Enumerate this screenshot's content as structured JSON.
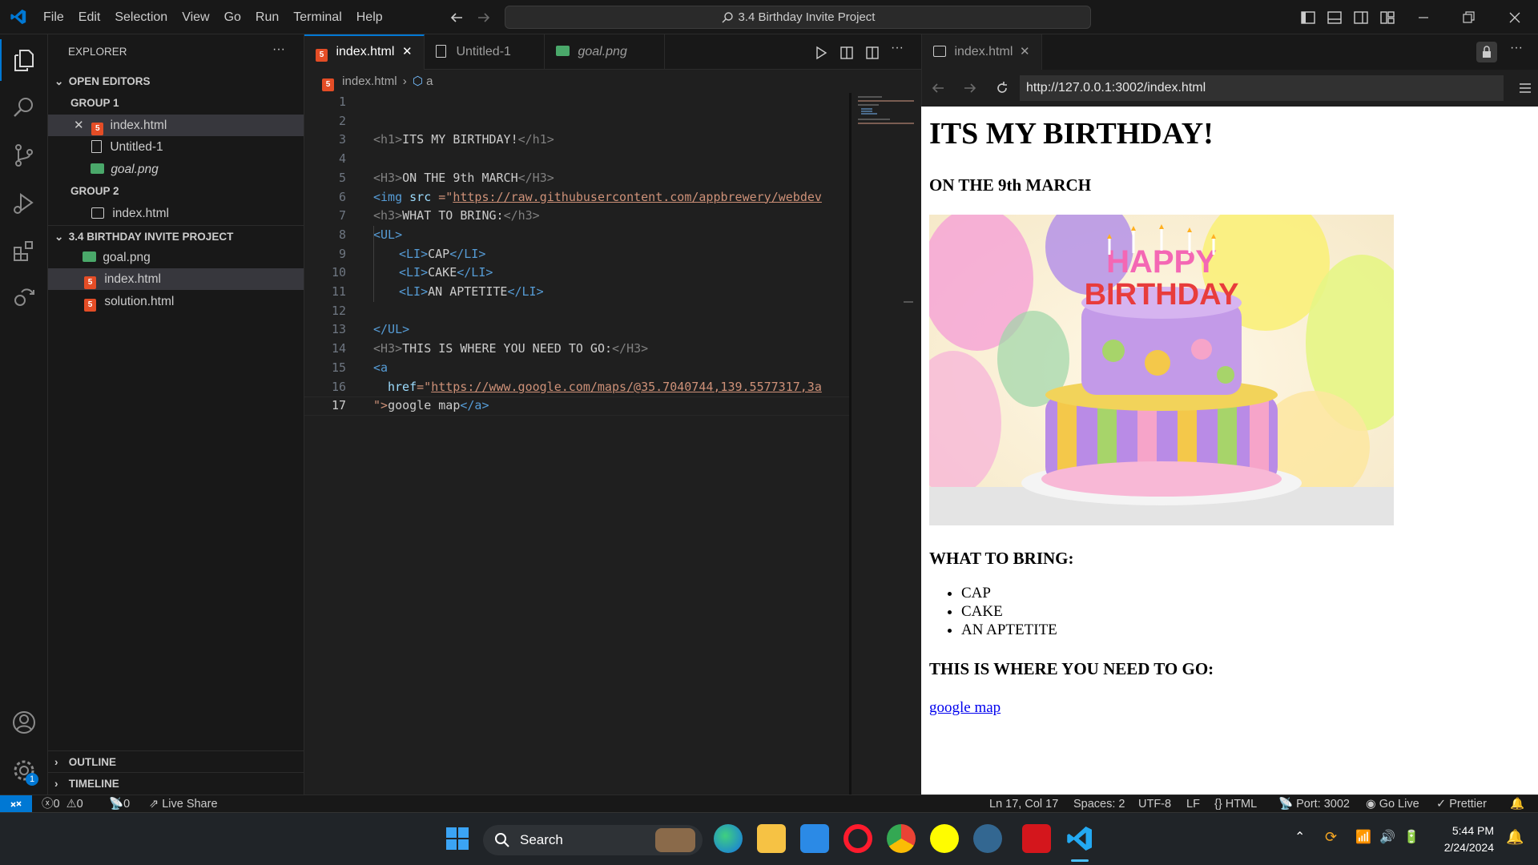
{
  "titlebar": {
    "menus": [
      "File",
      "Edit",
      "Selection",
      "View",
      "Go",
      "Run",
      "Terminal",
      "Help"
    ],
    "command_center": "3.4 Birthday Invite Project"
  },
  "sidebar": {
    "title": "EXPLORER",
    "open_editors": "OPEN EDITORS",
    "group1": "GROUP 1",
    "group1_files": [
      "index.html",
      "Untitled-1",
      "goal.png"
    ],
    "group2": "GROUP 2",
    "group2_files": [
      "index.html"
    ],
    "project": "3.4 BIRTHDAY INVITE PROJECT",
    "project_files": [
      "goal.png",
      "index.html",
      "solution.html"
    ],
    "outline": "OUTLINE",
    "timeline": "TIMELINE",
    "settings_badge": "1"
  },
  "editor": {
    "tabs": [
      "index.html",
      "Untitled-1",
      "goal.png"
    ],
    "breadcrumb_file": "index.html",
    "breadcrumb_symbol": "a",
    "line_numbers": [
      "1",
      "2",
      "3",
      "4",
      "5",
      "6",
      "7",
      "8",
      "9",
      "10",
      "11",
      "12",
      "13",
      "14",
      "15",
      "16",
      "17"
    ],
    "lines": {
      "l3_tag_open": "<h1>",
      "l3_text": "ITS MY BIRTHDAY!",
      "l3_tag_close": "</h1>",
      "l5_tag_open": "<H3>",
      "l5_text": "ON THE 9th MARCH",
      "l5_tag_close": "</H3>",
      "l6_tag": "<img",
      "l6_attr": " src ",
      "l6_eq": "=\"",
      "l6_url": "https://raw.githubusercontent.com/appbrewery/webdev",
      "l7_tag_open": "<h3>",
      "l7_text": "WHAT TO BRING:",
      "l7_tag_close": "</h3>",
      "l8_tag": "<UL>",
      "l9_tag_open": "<LI>",
      "l9_text": "CAP",
      "l9_tag_close": "</LI>",
      "l10_tag_open": "<LI>",
      "l10_text": "CAKE",
      "l10_tag_close": "</LI>",
      "l11_tag_open": "<LI>",
      "l11_text": "AN APTETITE",
      "l11_tag_close": "</LI>",
      "l13_tag": "</UL>",
      "l14_tag_open": "<H3>",
      "l14_text": "THIS IS WHERE YOU NEED TO GO:",
      "l14_tag_close": "</H3>",
      "l15_tag": "<a",
      "l16_attr": "href",
      "l16_eq": "=\"",
      "l16_url": "https://www.google.com/maps/@35.7040744,139.5577317,3a",
      "l17_quote": "\">",
      "l17_text": "google map",
      "l17_tag_close": "</a>"
    }
  },
  "preview": {
    "tab": "index.html",
    "url": "http://127.0.0.1:3002/index.html",
    "h1": "ITS MY BIRTHDAY!",
    "date_heading": "ON THE 9th MARCH",
    "bring_heading": "WHAT TO BRING:",
    "bring_items": [
      "CAP",
      "CAKE",
      "AN APTETITE"
    ],
    "where_heading": "THIS IS WHERE YOU NEED TO GO:",
    "link_text": "google map",
    "cake_text": "HAPPY BIRTHDAY"
  },
  "statusbar": {
    "errors": "0",
    "warnings": "0",
    "ports": "0",
    "live_share": "Live Share",
    "position": "Ln 17, Col 17",
    "spaces": "Spaces: 2",
    "encoding": "UTF-8",
    "eol": "LF",
    "language": "HTML",
    "port": "Port: 3002",
    "go_live": "Go Live",
    "prettier": "Prettier"
  },
  "taskbar": {
    "search": "Search",
    "time": "5:44 PM",
    "date": "2/24/2024"
  }
}
